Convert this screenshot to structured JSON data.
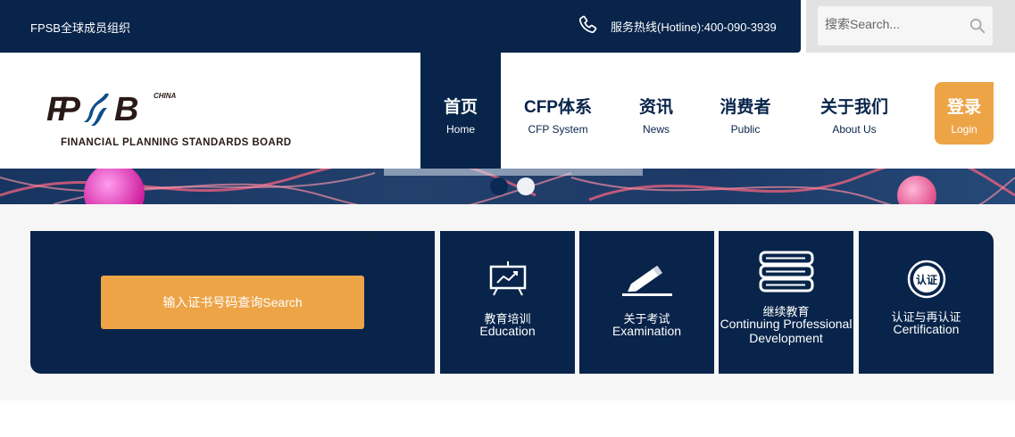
{
  "topbar": {
    "org_name": "FPSB全球成员组织",
    "hotline": "服务热线(Hotline):400-090-3939"
  },
  "search": {
    "placeholder": "搜索Search..."
  },
  "logo": {
    "mark": "FPSB",
    "country": "CHINA",
    "board_name": "FINANCIAL PLANNING STANDARDS BOARD"
  },
  "nav": {
    "items": [
      {
        "zh": "首页",
        "en": "Home",
        "active": true
      },
      {
        "zh": "CFP体系",
        "en": "CFP System"
      },
      {
        "zh": "资讯",
        "en": "News"
      },
      {
        "zh": "消费者",
        "en": "Public"
      },
      {
        "zh": "关于我们",
        "en": "About Us"
      }
    ],
    "login": {
      "zh": "登录",
      "en": "Login"
    }
  },
  "banner": {
    "slide_count": 2,
    "active_slide": 1
  },
  "content": {
    "stray_text": "-->",
    "query_button": "输入证书号码查询Search",
    "tiles": [
      {
        "zh": "教育培训",
        "en": "Education",
        "icon": "presentation-chart-icon"
      },
      {
        "zh": "关于考试",
        "en": "Examination",
        "icon": "pen-icon"
      },
      {
        "zh": "继续教育",
        "en": "Continuing Professional Development",
        "icon": "books-icon"
      },
      {
        "zh": "认证与再认证",
        "en": "Certification",
        "icon": "certification-seal-icon"
      }
    ]
  },
  "colors": {
    "navy": "#08244a",
    "orange": "#eda447",
    "light_gray": "#f6f6f6"
  }
}
